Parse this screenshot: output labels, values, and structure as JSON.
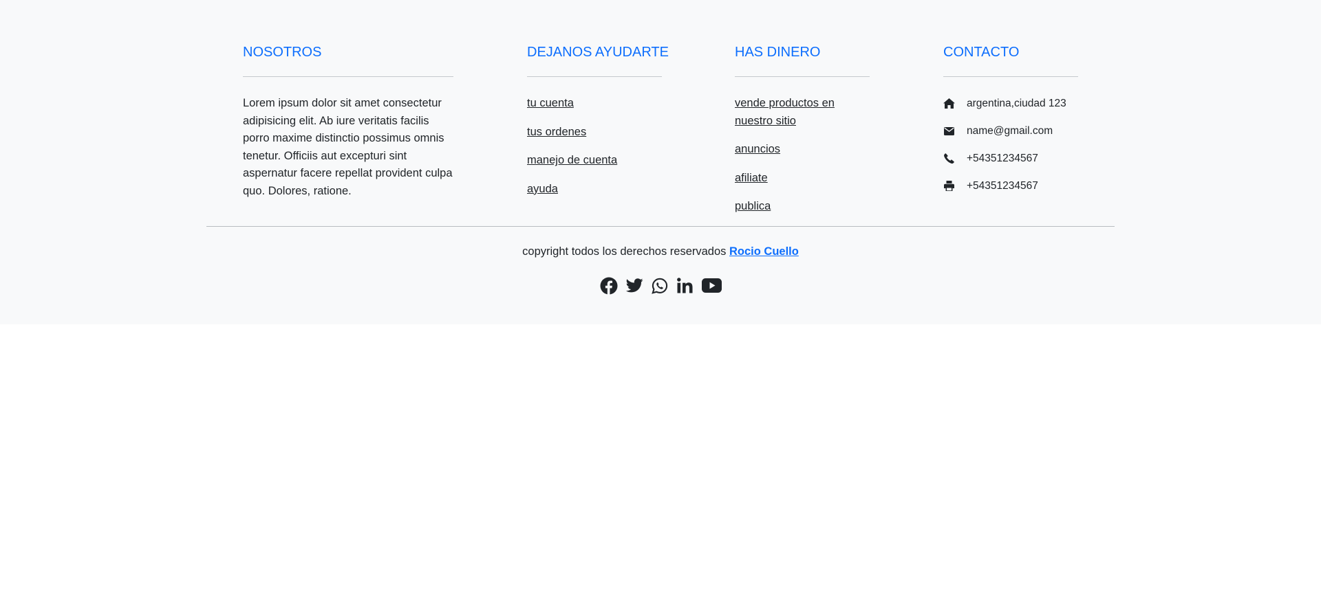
{
  "footer": {
    "nosotros": {
      "title": "NOSOTROS",
      "text": "Lorem ipsum dolor sit amet consectetur adipisicing elit. Ab iure veritatis facilis porro maxime distinctio possimus omnis tenetur. Officiis aut excepturi sint aspernatur facere repellat provident culpa quo. Dolores, ratione."
    },
    "ayuda": {
      "title": "DEJANOS AYUDARTE",
      "links": [
        "tu cuenta",
        "tus ordenes",
        "manejo de cuenta",
        "ayuda"
      ]
    },
    "dinero": {
      "title": "HAS DINERO",
      "links": [
        "vende productos en nuestro sitio",
        "anuncios",
        "afiliate",
        "publica"
      ]
    },
    "contacto": {
      "title": "CONTACTO",
      "items": [
        {
          "icon": "home-icon",
          "text": "argentina,ciudad 123"
        },
        {
          "icon": "envelope-icon",
          "text": "name@gmail.com"
        },
        {
          "icon": "phone-icon",
          "text": "+54351234567"
        },
        {
          "icon": "print-icon",
          "text": "+54351234567"
        }
      ]
    },
    "copyright": {
      "text": "copyright todos los derechos reservados",
      "author": "Rocio Cuello"
    },
    "social": [
      "facebook-icon",
      "twitter-icon",
      "whatsapp-icon",
      "linkedin-icon",
      "youtube-icon"
    ],
    "colors": {
      "accent": "#0d6efd",
      "text": "#212529",
      "background": "#f8f9fa"
    }
  }
}
